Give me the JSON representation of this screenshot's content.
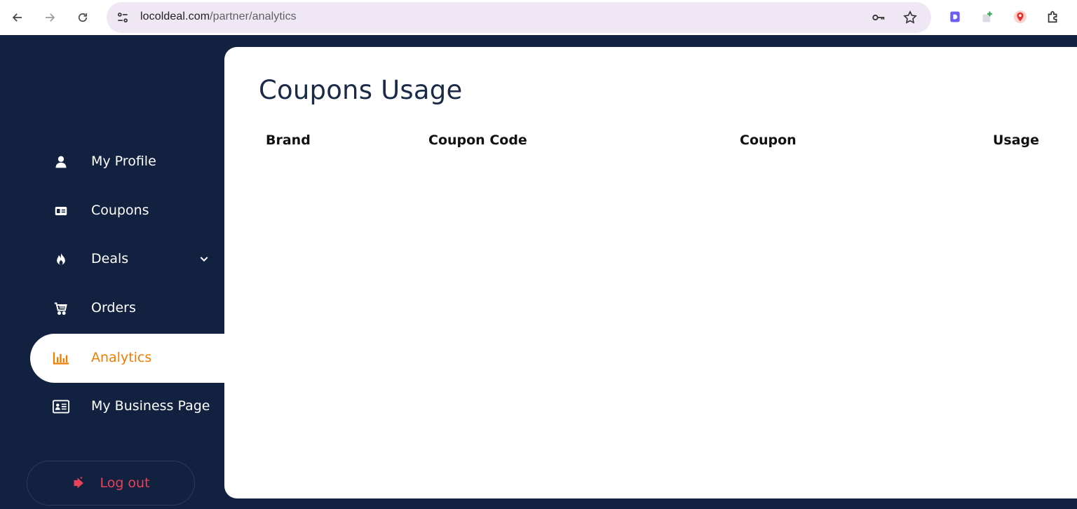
{
  "browser": {
    "url_host": "locoldeal.com",
    "url_path": "/partner/analytics"
  },
  "sidebar": {
    "items": [
      {
        "label": "My Profile",
        "icon": "user-icon"
      },
      {
        "label": "Coupons",
        "icon": "coupon-card-icon"
      },
      {
        "label": "Deals",
        "icon": "fire-icon",
        "has_dropdown": true
      },
      {
        "label": "Orders",
        "icon": "cart-icon"
      },
      {
        "label": "Analytics",
        "icon": "bar-chart-icon",
        "active": true
      },
      {
        "label": "My Business Page",
        "icon": "id-card-icon"
      }
    ],
    "logout_label": "Log out"
  },
  "main": {
    "title": "Coupons Usage",
    "table": {
      "headers": [
        "Brand",
        "Coupon Code",
        "Coupon",
        "Usage"
      ],
      "rows": []
    }
  },
  "colors": {
    "sidebar_bg": "#11213f",
    "accent": "#f07d00",
    "logout": "#e8415a",
    "title": "#1c2a49"
  }
}
